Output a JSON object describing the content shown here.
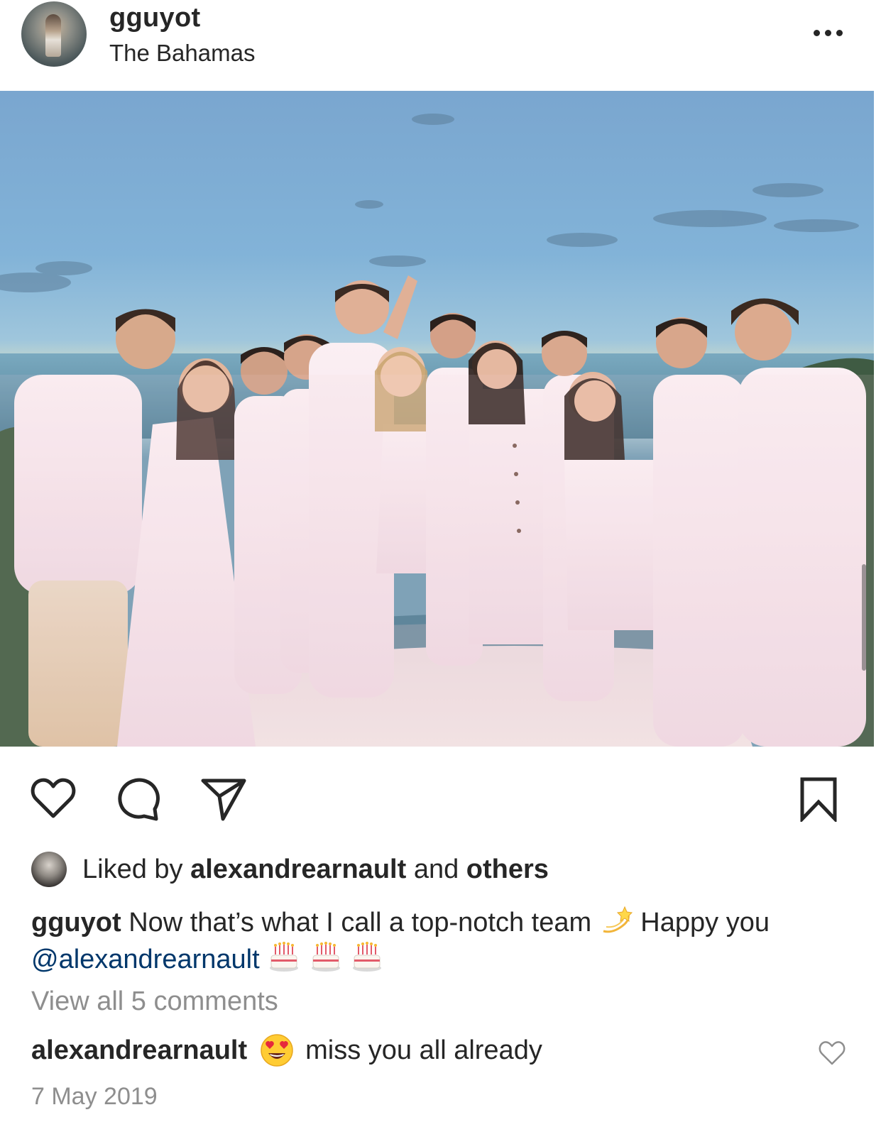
{
  "post": {
    "username": "gguyot",
    "location": "The Bahamas",
    "more_icon": "more-horizontal-icon"
  },
  "actions": {
    "like_icon": "heart-outline-icon",
    "comment_icon": "comment-bubble-icon",
    "share_icon": "paper-plane-icon",
    "save_icon": "bookmark-outline-icon"
  },
  "likes": {
    "prefix": "Liked by",
    "user": "alexandrearnault",
    "middle": "and",
    "others": "others"
  },
  "caption": {
    "username": "gguyot",
    "text_1": "Now that’s what I call a top-notch team",
    "text_2": "Happy you",
    "mention": "@alexandrearnault",
    "emojis": [
      "dizzy-star",
      "birthday-cake",
      "birthday-cake",
      "birthday-cake"
    ]
  },
  "view_all_comments": "View all 5 comments",
  "comment": {
    "username": "alexandrearnault",
    "emoji": "heart-eyes-face",
    "text": "miss you all already"
  },
  "date": "7 May 2019",
  "colors": {
    "text": "#262626",
    "muted": "#8e8e8e",
    "mention": "#00376b"
  }
}
